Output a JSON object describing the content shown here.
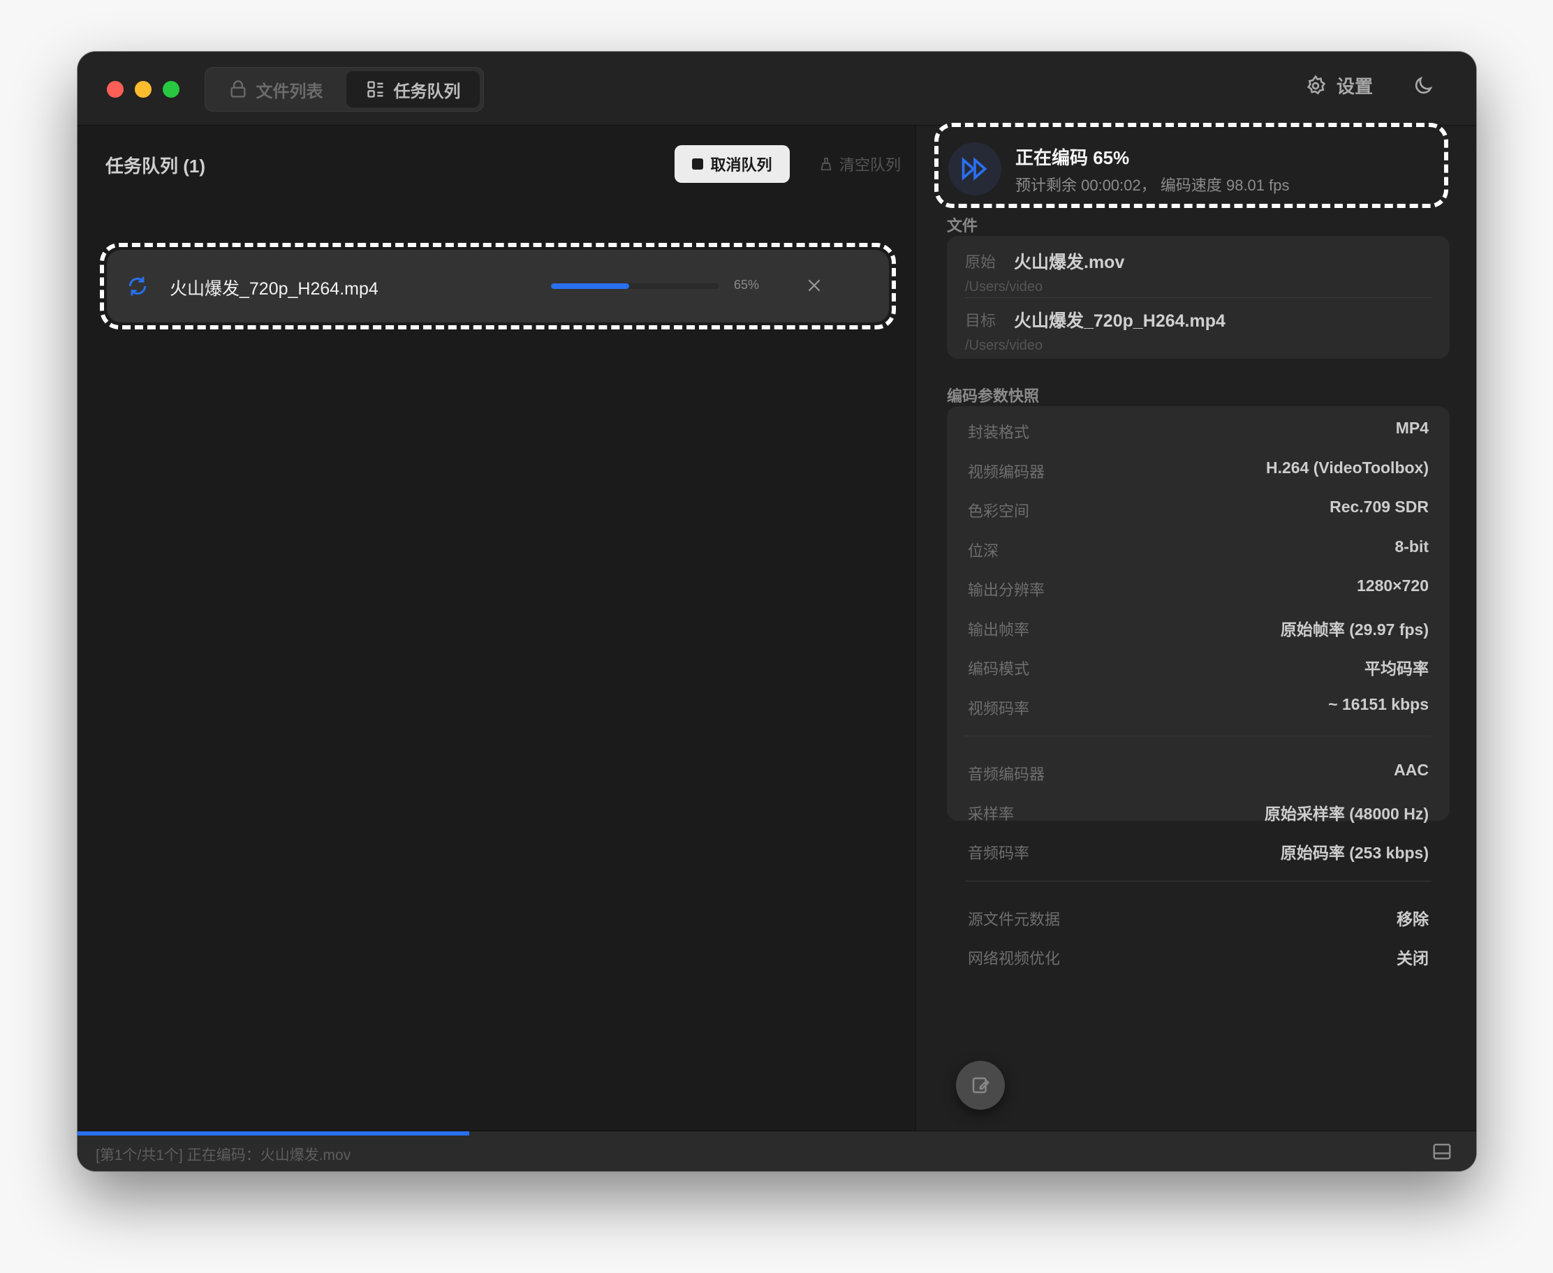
{
  "titlebar": {
    "tabs": [
      {
        "label": "文件列表",
        "icon": "folder-icon",
        "active": false
      },
      {
        "label": "任务队列",
        "icon": "grid-icon",
        "active": true
      }
    ],
    "settings_label": "设置",
    "theme_icon": "moon-icon"
  },
  "queue": {
    "title": "任务队列 (1)",
    "cancel_label": "取消队列",
    "clear_label": "清空队列",
    "tasks": [
      {
        "name": "火山爆发_720p_H264.mp4",
        "progress": 0.65,
        "progress_label": "65%",
        "icon": "sync-icon"
      }
    ]
  },
  "status": {
    "title": "正在编码 65%",
    "subtitle": "预计剩余 00:00:02， 编码速度 98.01 fps",
    "icon": "fast-forward-icon"
  },
  "files": {
    "section_label": "文件",
    "source": {
      "key": "原始",
      "name": "火山爆发.mov",
      "path": "/Users/video"
    },
    "target": {
      "key": "目标",
      "name": "火山爆发_720p_H264.mp4",
      "path": "/Users/video"
    }
  },
  "params": {
    "section_label": "编码参数快照",
    "video": [
      {
        "k": "封装格式",
        "v": "MP4"
      },
      {
        "k": "视频编码器",
        "v": "H.264 (VideoToolbox)"
      },
      {
        "k": "色彩空间",
        "v": "Rec.709 SDR"
      },
      {
        "k": "位深",
        "v": "8-bit"
      },
      {
        "k": "输出分辨率",
        "v": "1280×720"
      },
      {
        "k": "输出帧率",
        "v": "原始帧率 (29.97 fps)"
      },
      {
        "k": "编码模式",
        "v": "平均码率"
      },
      {
        "k": "视频码率",
        "v": "~ 16151 kbps"
      }
    ],
    "audio": [
      {
        "k": "音频编码器",
        "v": "AAC"
      },
      {
        "k": "采样率",
        "v": "原始采样率 (48000 Hz)"
      },
      {
        "k": "音频码率",
        "v": "原始码率 (253 kbps)"
      }
    ],
    "misc": [
      {
        "k": "源文件元数据",
        "v": "移除"
      },
      {
        "k": "网络视频优化",
        "v": "关闭"
      }
    ]
  },
  "statusbar": {
    "text": "[第1个/共1个]  正在编码：火山爆发.mov",
    "progress": 0.28,
    "icon": "sidebar-toggle-icon"
  },
  "colors": {
    "accent": "#2a6ff0",
    "window_bg": "#1c1c1c"
  }
}
